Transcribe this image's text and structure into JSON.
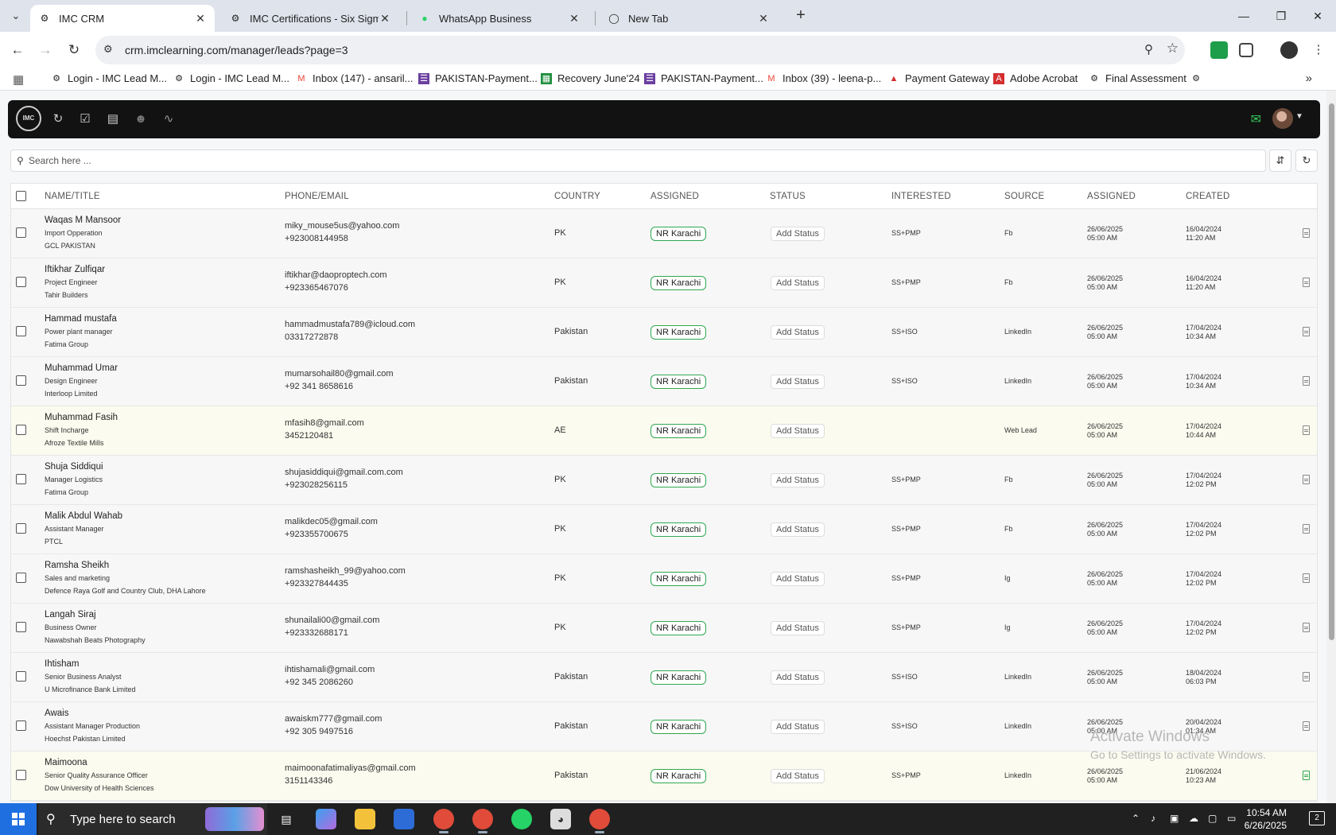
{
  "browser": {
    "tabs": [
      {
        "title": "IMC CRM",
        "active": true
      },
      {
        "title": "IMC Certifications - Six Sigma G",
        "active": false
      },
      {
        "title": "WhatsApp Business",
        "active": false
      },
      {
        "title": "New Tab",
        "active": false
      }
    ],
    "url": "crm.imclearning.com/manager/leads?page=3",
    "bookmarks": [
      "Login - IMC Lead M...",
      "Login - IMC Lead M...",
      "Inbox (147) - ansaril...",
      "PAKISTAN-Payment...",
      "Recovery June'24",
      "PAKISTAN-Payment...",
      "Inbox (39) - leena-p...",
      "Payment Gateway",
      "Adobe Acrobat",
      "Final Assessment"
    ]
  },
  "app": {
    "logo_text": "IMC",
    "search_placeholder": "Search here ...",
    "columns": [
      "NAME/TITLE",
      "PHONE/EMAIL",
      "COUNTRY",
      "ASSIGNED",
      "STATUS",
      "INTERESTED",
      "SOURCE",
      "ASSIGNED",
      "CREATED"
    ],
    "status_label": "Add Status",
    "rows": [
      {
        "name": "Waqas M Mansoor",
        "title": "Import Opperation",
        "company": "GCL PAKISTAN",
        "email": "miky_mouse5us@yahoo.com",
        "phone": "+923008144958",
        "country": "PK",
        "assigned": "NR Karachi",
        "interested": "SS+PMP",
        "source": "Fb",
        "assigned_date": "26/06/2025",
        "assigned_time": "05:00 AM",
        "created_date": "16/04/2024",
        "created_time": "11:20 AM"
      },
      {
        "name": "Iftikhar Zulfiqar",
        "title": "Project Engineer",
        "company": "Tahir Builders",
        "email": "iftikhar@daoproptech.com",
        "phone": "+923365467076",
        "country": "PK",
        "assigned": "NR Karachi",
        "interested": "SS+PMP",
        "source": "Fb",
        "assigned_date": "26/06/2025",
        "assigned_time": "05:00 AM",
        "created_date": "16/04/2024",
        "created_time": "11:20 AM"
      },
      {
        "name": "Hammad mustafa",
        "title": "Power plant manager",
        "company": "Fatima Group",
        "email": "hammadmustafa789@icloud.com",
        "phone": "03317272878",
        "country": "Pakistan",
        "assigned": "NR Karachi",
        "interested": "SS+ISO",
        "source": "LinkedIn",
        "assigned_date": "26/06/2025",
        "assigned_time": "05:00 AM",
        "created_date": "17/04/2024",
        "created_time": "10:34 AM"
      },
      {
        "name": "Muhammad Umar",
        "title": "Design Engineer",
        "company": "Interloop Limited",
        "email": "mumarsohail80@gmail.com",
        "phone": "+92 341 8658616",
        "country": "Pakistan",
        "assigned": "NR Karachi",
        "interested": "SS+ISO",
        "source": "LinkedIn",
        "assigned_date": "26/06/2025",
        "assigned_time": "05:00 AM",
        "created_date": "17/04/2024",
        "created_time": "10:34 AM"
      },
      {
        "name": "Muhammad Fasih",
        "title": "Shift Incharge",
        "company": "Afroze Textile Mills",
        "email": "mfasih8@gmail.com",
        "phone": "3452120481",
        "country": "AE",
        "assigned": "NR Karachi",
        "interested": "",
        "source": "Web Lead",
        "assigned_date": "26/06/2025",
        "assigned_time": "05:00 AM",
        "created_date": "17/04/2024",
        "created_time": "10:44 AM",
        "highlight": true
      },
      {
        "name": "Shuja Siddiqui",
        "title": "Manager Logistics",
        "company": "Fatima Group",
        "email": "shujasiddiqui@gmail.com.com",
        "phone": "+923028256115",
        "country": "PK",
        "assigned": "NR Karachi",
        "interested": "SS+PMP",
        "source": "Fb",
        "assigned_date": "26/06/2025",
        "assigned_time": "05:00 AM",
        "created_date": "17/04/2024",
        "created_time": "12:02 PM"
      },
      {
        "name": "Malik Abdul Wahab",
        "title": "Assistant Manager",
        "company": "PTCL",
        "email": "malikdec05@gmail.com",
        "phone": "+923355700675",
        "country": "PK",
        "assigned": "NR Karachi",
        "interested": "SS+PMP",
        "source": "Fb",
        "assigned_date": "26/06/2025",
        "assigned_time": "05:00 AM",
        "created_date": "17/04/2024",
        "created_time": "12:02 PM"
      },
      {
        "name": "Ramsha Sheikh",
        "title": "Sales and marketing",
        "company": "Defence Raya Golf and Country Club, DHA Lahore",
        "email": "ramshasheikh_99@yahoo.com",
        "phone": "+923327844435",
        "country": "PK",
        "assigned": "NR Karachi",
        "interested": "SS+PMP",
        "source": "Ig",
        "assigned_date": "26/06/2025",
        "assigned_time": "05:00 AM",
        "created_date": "17/04/2024",
        "created_time": "12:02 PM"
      },
      {
        "name": "Langah Siraj",
        "title": "Business Owner",
        "company": "Nawabshah Beats Photography",
        "email": "shunailali00@gmail.com",
        "phone": "+923332688171",
        "country": "PK",
        "assigned": "NR Karachi",
        "interested": "SS+PMP",
        "source": "Ig",
        "assigned_date": "26/06/2025",
        "assigned_time": "05:00 AM",
        "created_date": "17/04/2024",
        "created_time": "12:02 PM"
      },
      {
        "name": "Ihtisham",
        "title": "Senior Business Analyst",
        "company": "U Microfinance Bank Limited",
        "email": "ihtishamali@gmail.com",
        "phone": "+92 345 2086260",
        "country": "Pakistan",
        "assigned": "NR Karachi",
        "interested": "SS+ISO",
        "source": "LinkedIn",
        "assigned_date": "26/06/2025",
        "assigned_time": "05:00 AM",
        "created_date": "18/04/2024",
        "created_time": "06:03 PM"
      },
      {
        "name": "Awais",
        "title": "Assistant Manager Production",
        "company": "Hoechst Pakistan Limited",
        "email": "awaiskm777@gmail.com",
        "phone": "+92 305 9497516",
        "country": "Pakistan",
        "assigned": "NR Karachi",
        "interested": "SS+ISO",
        "source": "LinkedIn",
        "assigned_date": "26/06/2025",
        "assigned_time": "05:00 AM",
        "created_date": "20/04/2024",
        "created_time": "01:34 AM"
      },
      {
        "name": "Maimoona",
        "title": "Senior Quality Assurance Officer",
        "company": "Dow University of Health Sciences",
        "email": "maimoonafatimaliyas@gmail.com",
        "phone": "3151143346",
        "country": "Pakistan",
        "assigned": "NR Karachi",
        "interested": "SS+PMP",
        "source": "LinkedIn",
        "assigned_date": "26/06/2025",
        "assigned_time": "05:00 AM",
        "created_date": "21/06/2024",
        "created_time": "10:23 AM",
        "highlight": true,
        "doc_green": true
      }
    ]
  },
  "watermark": {
    "line1": "Activate Windows",
    "line2": "Go to Settings to activate Windows."
  },
  "taskbar": {
    "search_placeholder": "Type here to search",
    "time": "10:54 AM",
    "date": "6/26/2025",
    "notifications": "2"
  },
  "colors": {
    "accent_green": "#2fa84f",
    "header_bg": "#121212"
  }
}
